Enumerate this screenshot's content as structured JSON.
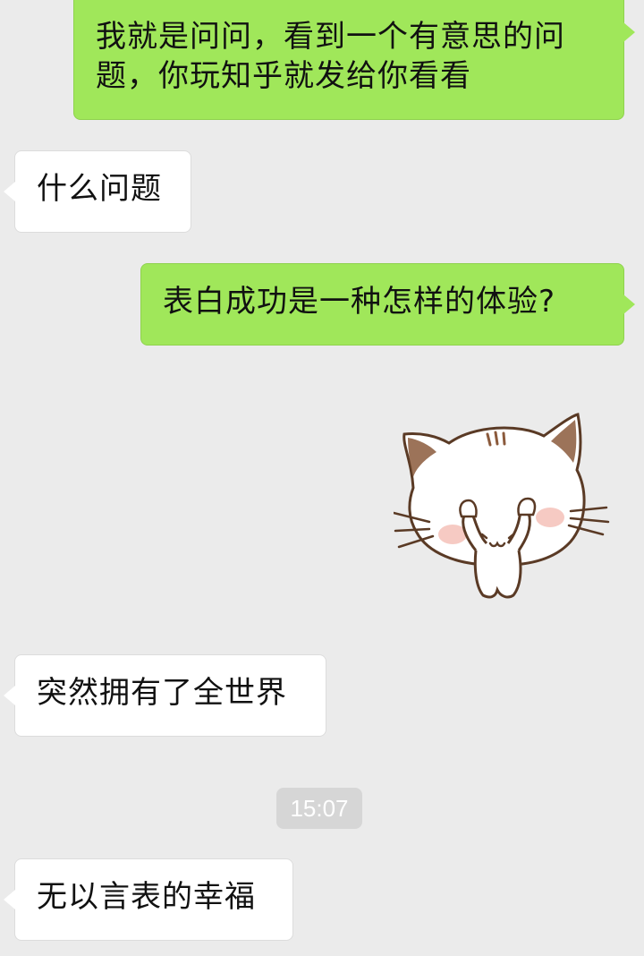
{
  "messages": [
    {
      "id": "m1",
      "direction": "outgoing",
      "text": "我就是问问，看到一个有意思的问题，你玩知乎就发给你看看"
    },
    {
      "id": "m2",
      "direction": "incoming",
      "text": "什么问题"
    },
    {
      "id": "m3",
      "direction": "outgoing",
      "text": "表白成功是一种怎样的体验?"
    },
    {
      "id": "m4",
      "direction": "outgoing",
      "type": "sticker",
      "sticker": "white-cat-sticker"
    },
    {
      "id": "m5",
      "direction": "incoming",
      "text": "突然拥有了全世界"
    },
    {
      "id": "m6",
      "direction": "incoming",
      "text": "无以言表的幸福"
    }
  ],
  "timestamp": "15:07",
  "colors": {
    "background": "#ebebeb",
    "outgoing_bubble": "#a0e75a",
    "incoming_bubble": "#ffffff",
    "timestamp_bg": "#d6d6d6"
  }
}
